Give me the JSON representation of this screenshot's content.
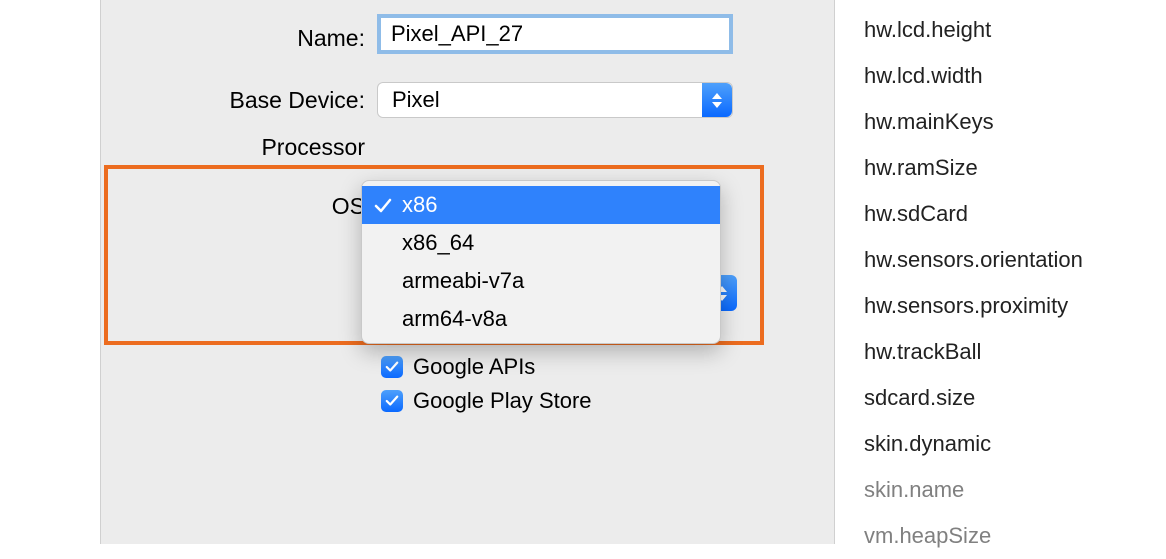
{
  "form": {
    "name_label": "Name:",
    "name_value": "Pixel_API_27",
    "base_label": "Base Device:",
    "base_value": "Pixel",
    "processor_label": "Processor",
    "os_label": "OS",
    "google_apis_label": "Google APIs",
    "google_play_label": "Google Play Store"
  },
  "dropdown": {
    "items": [
      "x86",
      "x86_64",
      "armeabi-v7a",
      "arm64-v8a"
    ],
    "selected_index": 0
  },
  "side_properties": [
    "hw.lcd.height",
    "hw.lcd.width",
    "hw.mainKeys",
    "hw.ramSize",
    "hw.sdCard",
    "hw.sensors.orientation",
    "hw.sensors.proximity",
    "hw.trackBall",
    "sdcard.size",
    "skin.dynamic",
    "skin.name",
    "vm.heapSize"
  ],
  "side_dim_indexes": [
    10,
    11
  ]
}
